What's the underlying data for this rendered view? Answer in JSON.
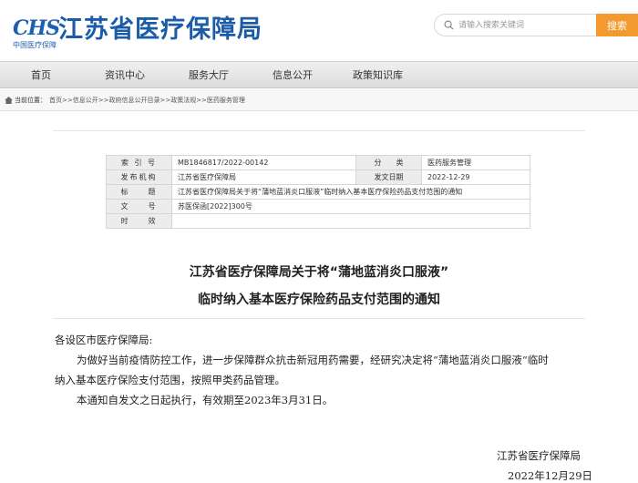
{
  "header": {
    "logo_abbr": "CHS",
    "logo_sub": "中国医疗保障",
    "site_title": "江苏省医疗保障局",
    "search_placeholder": "请输入搜索关键词",
    "search_button": "搜索"
  },
  "nav": {
    "items": [
      "首页",
      "资讯中心",
      "服务大厅",
      "信息公开",
      "政策知识库"
    ]
  },
  "breadcrumb": {
    "label": "当前位置：",
    "path": "首页>>信息公开>>政府信息公开目录>>政策法规>>医药服务管理"
  },
  "meta": {
    "index_label": "索 引 号",
    "index_value": "MB1846817/2022-00142",
    "category_label": "分　　类",
    "category_value": "医药服务管理",
    "agency_label": "发布机构",
    "agency_value": "江苏省医疗保障局",
    "date_label": "发文日期",
    "date_value": "2022-12-29",
    "title_label": "标　　题",
    "title_value": "江苏省医疗保障局关于将“蒲地蓝消炎口服液”临时纳入基本医疗保险药品支付范围的通知",
    "docno_label": "文　　号",
    "docno_value": "苏医保函[2022]300号",
    "validity_label": "时　　效",
    "validity_value": ""
  },
  "document": {
    "title_line1": "江苏省医疗保障局关于将“蒲地蓝消炎口服液”",
    "title_line2": "临时纳入基本医疗保险药品支付范围的通知",
    "salutation": "各设区市医疗保障局:",
    "para1_line1": "为做好当前疫情防控工作，进一步保障群众抗击新冠用药需要，经研究决定将“蒲地蓝消炎口服液”临时",
    "para1_line2": "纳入基本医疗保险支付范围，按照甲类药品管理。",
    "para2": "本通知自发文之日起执行，有效期至2023年3月31日。",
    "signature": "江苏省医疗保障局",
    "sign_date": "2022年12月29日"
  },
  "colors": {
    "brand_blue": "#1b5ca8",
    "search_orange": "#f29a2e"
  }
}
